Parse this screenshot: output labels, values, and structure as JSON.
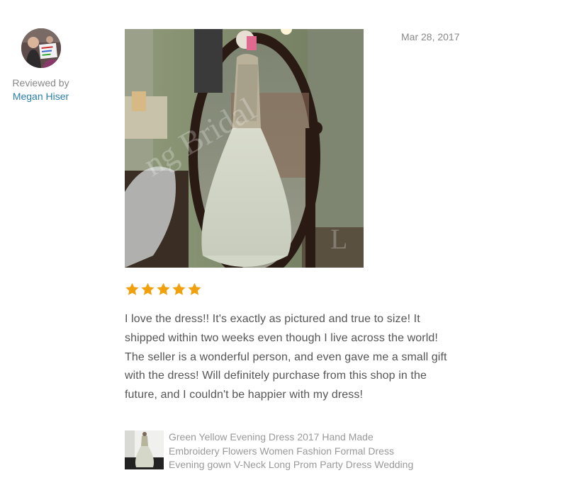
{
  "reviewer": {
    "reviewed_by_label": "Reviewed by",
    "name": "Megan Hiser",
    "avatar_icon": "user-avatar-photo"
  },
  "review": {
    "date": "Mar 28, 2017",
    "rating": 5,
    "rating_max": 5,
    "star_color": "#f1a10e",
    "text": "I love the dress!! It's exactly as pictured and true to size! It shipped within two weeks even though I live across the world! The seller is a wonderful person, and even gave me a small gift with the dress! Will definitely purchase from this shop in the future, and I couldn't be happier with my dress!",
    "photo_icon": "review-photo-mirror-selfie"
  },
  "product": {
    "title": "Green Yellow Evening Dress 2017 Hand Made Embroidery Flowers Women Fashion Formal Dress Evening gown V-Neck Long Prom Party Dress Wedding",
    "thumb_icon": "product-thumbnail-dress"
  },
  "colors": {
    "link": "#2a7fa9",
    "muted": "#888888",
    "body_text": "#555555"
  }
}
